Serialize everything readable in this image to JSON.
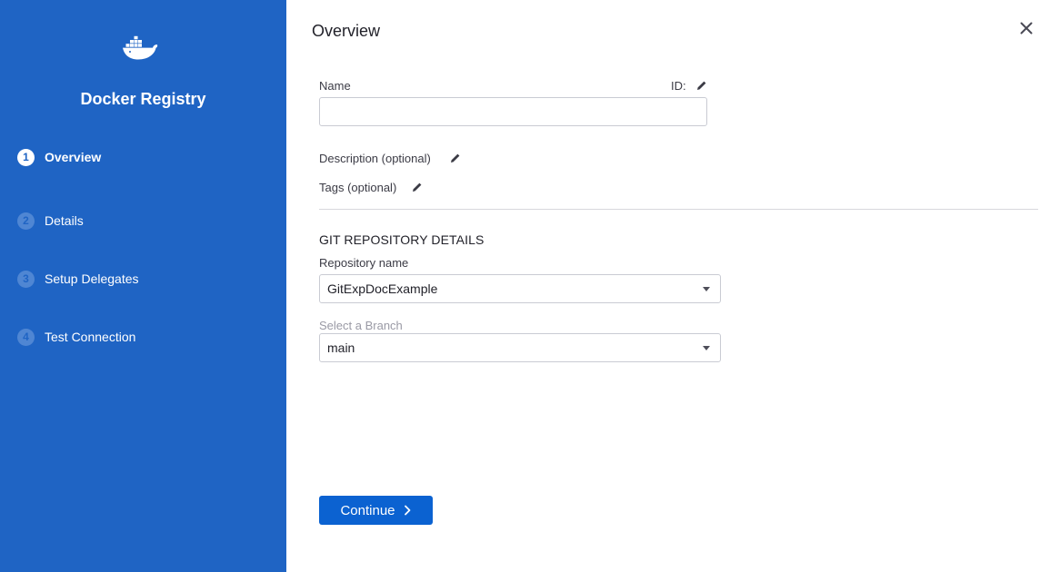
{
  "sidebar": {
    "brand": "Docker Registry",
    "logo_icon": "docker-whale-icon",
    "steps": [
      {
        "num": "1",
        "label": "Overview",
        "active": true
      },
      {
        "num": "2",
        "label": "Details",
        "active": false
      },
      {
        "num": "3",
        "label": "Setup Delegates",
        "active": false
      },
      {
        "num": "4",
        "label": "Test Connection",
        "active": false
      }
    ]
  },
  "main": {
    "title": "Overview",
    "name_label": "Name",
    "id_label": "ID:",
    "name_value": "",
    "description_label": "Description (optional)",
    "tags_label": "Tags (optional)",
    "git_section": "GIT REPOSITORY DETAILS",
    "repo_label": "Repository name",
    "repo_value": "GitExpDocExample",
    "branch_label": "Select a Branch",
    "branch_value": "main",
    "continue_label": "Continue"
  },
  "colors": {
    "sidebar_bg": "#1f64c4",
    "primary_button": "#0b62d1"
  }
}
